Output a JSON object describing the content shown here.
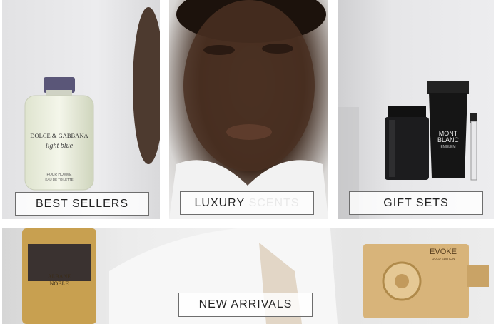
{
  "tiles": {
    "best_sellers": {
      "label": "BEST SELLERS",
      "bottle_brand": "DOLCE & GABBANA",
      "bottle_name": "light blue",
      "bottle_sub1": "POUR HOMME",
      "bottle_sub2": "EAU DE TOILETTE"
    },
    "luxury_scents": {
      "label_a": "LUXURY",
      "label_b": "SCENTS"
    },
    "gift_sets": {
      "label": "GIFT SETS",
      "tube_brand_1": "MONT",
      "tube_brand_2": "BLANC",
      "tube_name": "EMBLEM"
    },
    "new_arrivals": {
      "label": "NEW ARRIVALS",
      "bottle_text_1": "ALBANE",
      "bottle_text_2": "NOBLE",
      "box_brand": "EVOKE",
      "box_sub": "GOLD EDITION"
    }
  },
  "colors": {
    "label_border": "#6e6e6e",
    "label_text": "#222222",
    "gold": "#d8b47a"
  }
}
